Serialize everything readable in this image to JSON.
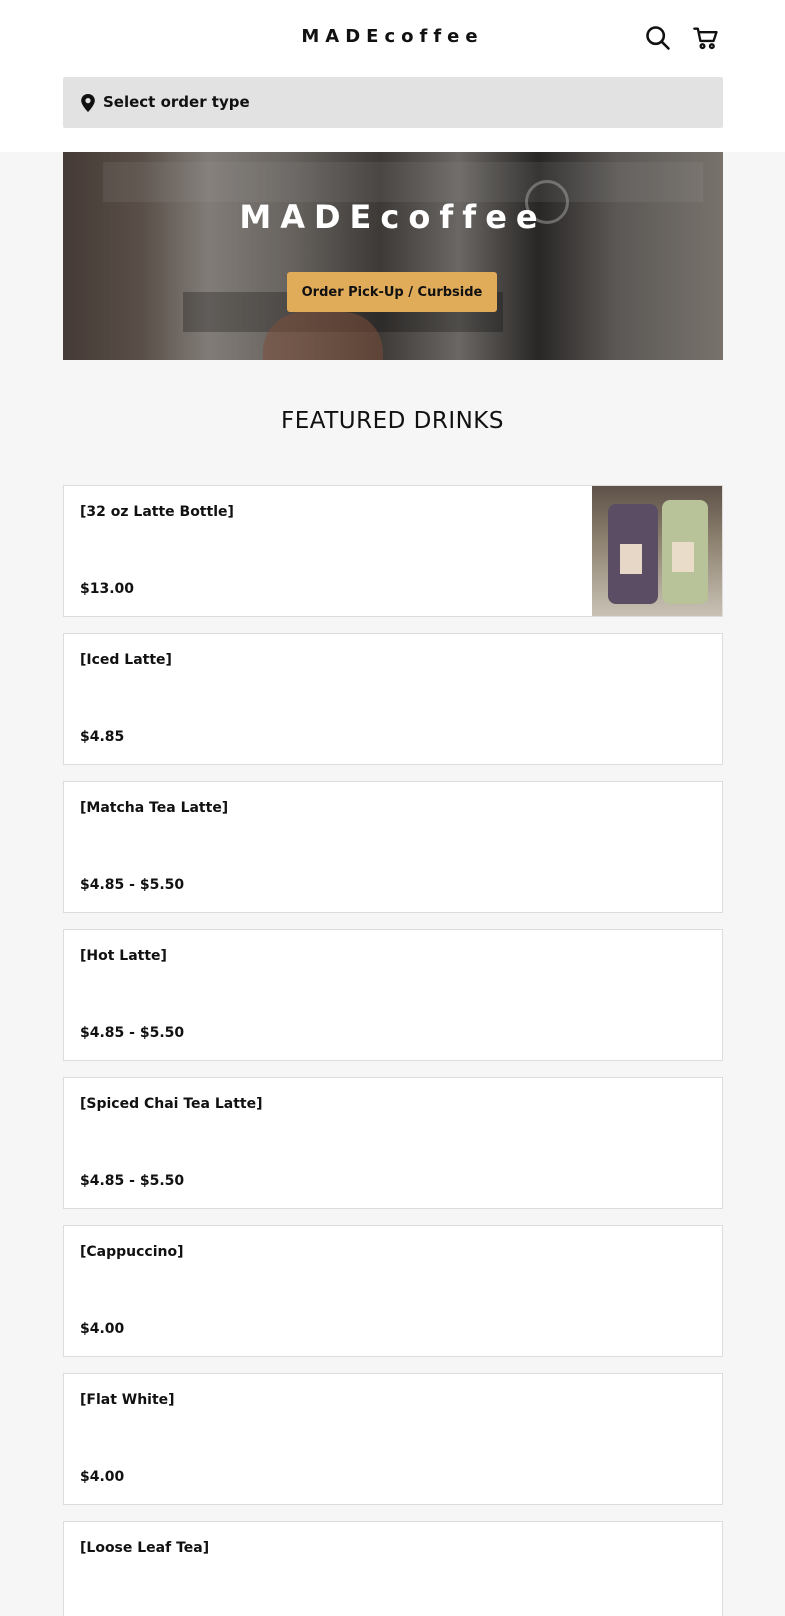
{
  "header": {
    "brand": "MADEcoffee",
    "order_type_label": "Select order type",
    "icons": [
      "search-icon",
      "cart-icon",
      "location-pin-icon"
    ]
  },
  "hero": {
    "title": "MADEcoffee",
    "button_label": "Order Pick-Up / Curbside",
    "button_color": "#e0ac5a"
  },
  "featured": {
    "title": "FEATURED DRINKS",
    "items": [
      {
        "name": "[32 oz Latte Bottle]",
        "price": "$13.00",
        "has_image": true
      },
      {
        "name": "[Iced Latte]",
        "price": "$4.85"
      },
      {
        "name": "[Matcha Tea Latte]",
        "price": "$4.85 - $5.50"
      },
      {
        "name": "[Hot Latte]",
        "price": "$4.85 - $5.50"
      },
      {
        "name": "[Spiced Chai Tea Latte]",
        "price": "$4.85 - $5.50"
      },
      {
        "name": "[Cappuccino]",
        "price": "$4.00"
      },
      {
        "name": "[Flat White]",
        "price": "$4.00"
      },
      {
        "name": "[Loose Leaf Tea]",
        "price": ""
      }
    ]
  }
}
